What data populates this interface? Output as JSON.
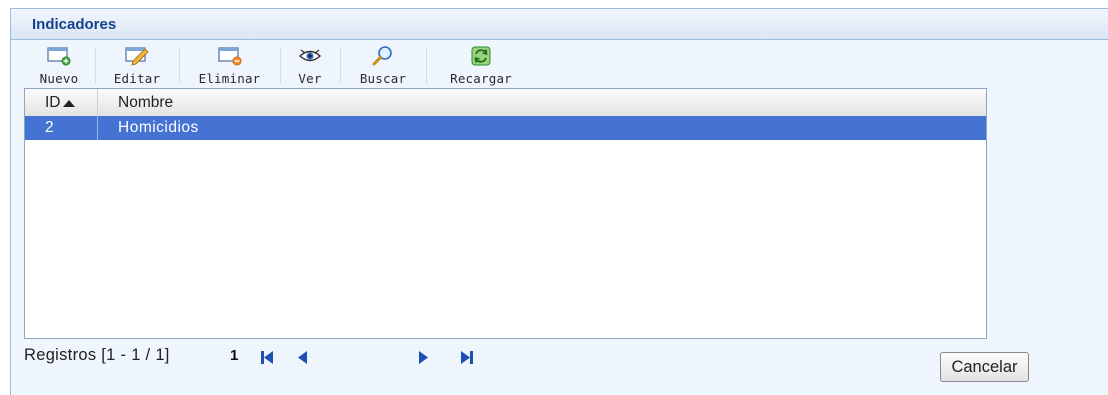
{
  "panel": {
    "title": "Indicadores"
  },
  "toolbar": {
    "buttons": [
      {
        "label": "Nuevo",
        "icon": "new-window-icon"
      },
      {
        "label": "Editar",
        "icon": "pencil-icon"
      },
      {
        "label": "Eliminar",
        "icon": "delete-window-icon"
      },
      {
        "label": "Ver",
        "icon": "eye-icon"
      },
      {
        "label": "Buscar",
        "icon": "magnifier-icon"
      },
      {
        "label": "Recargar",
        "icon": "refresh-icon"
      }
    ]
  },
  "grid": {
    "columns": [
      {
        "label": "ID",
        "sorted": "ascending"
      },
      {
        "label": "Nombre"
      }
    ],
    "rows": [
      {
        "id": "2",
        "nombre": "Homicidios",
        "selected": true
      }
    ],
    "selection_color": "#4473d4"
  },
  "pager": {
    "info": "Registros [1 - 1 / 1]",
    "current_page": "1",
    "icons": [
      "first-page-icon",
      "prev-page-icon",
      "next-page-icon",
      "last-page-icon"
    ]
  },
  "footer": {
    "cancel_label": "Cancelar"
  }
}
